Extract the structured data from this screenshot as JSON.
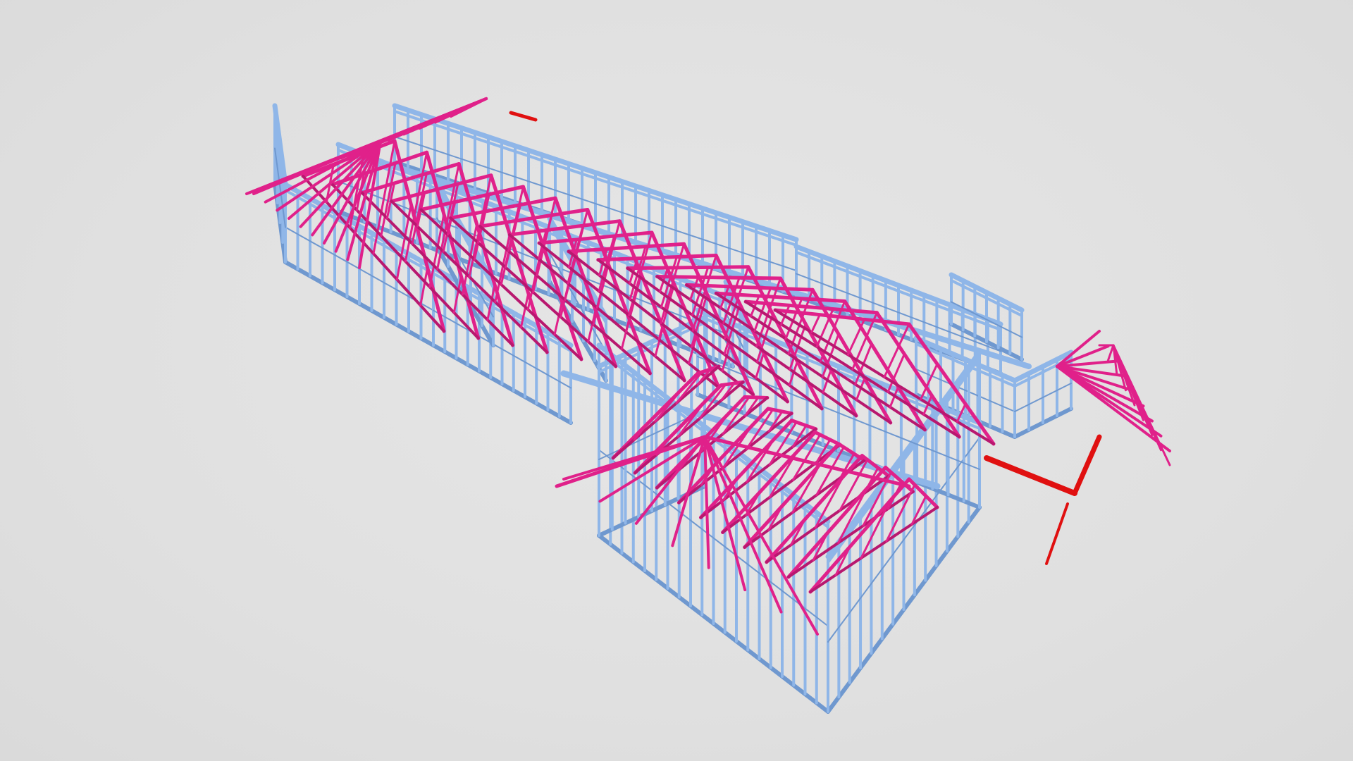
{
  "scene": {
    "subject": "",
    "colors": {
      "background": "#e2e2e2",
      "wall_frame": "#8fb6e8",
      "wall_frame_dark": "#6f98cf",
      "roof_truss": "#e0218a",
      "roof_truss_dark": "#b8186f",
      "beam": "#e01010"
    }
  }
}
